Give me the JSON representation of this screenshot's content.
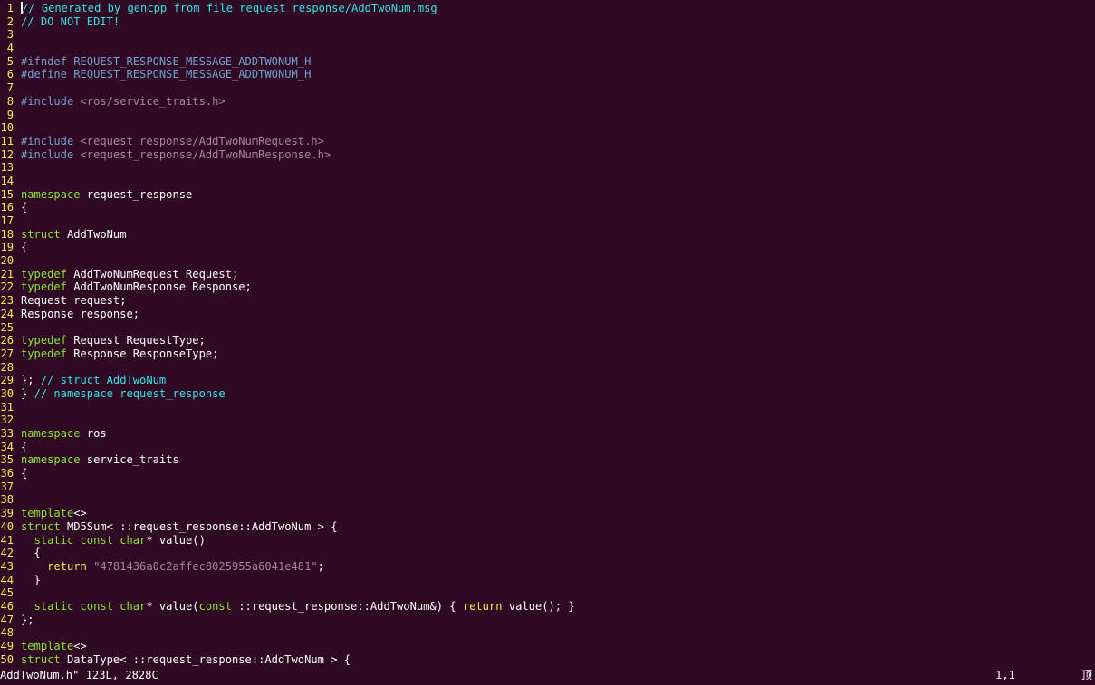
{
  "colors": {
    "background": "#300a24",
    "line_number": "#fce94f",
    "text": "#ffffff",
    "comment": "#34e2e2",
    "preproc": "#729fcf",
    "include_path": "#ad7fa8",
    "keyword": "#8ae234",
    "control": "#fce94f",
    "string": "#ad7fa8"
  },
  "editor": {
    "lines": [
      {
        "n": "1",
        "segs": [
          {
            "c": "comment",
            "t": "// Generated by gencpp from file request_response/AddTwoNum.msg"
          }
        ]
      },
      {
        "n": "2",
        "segs": [
          {
            "c": "comment",
            "t": "// DO NOT EDIT!"
          }
        ]
      },
      {
        "n": "3",
        "segs": []
      },
      {
        "n": "4",
        "segs": []
      },
      {
        "n": "5",
        "segs": [
          {
            "c": "preproc",
            "t": "#ifndef REQUEST_RESPONSE_MESSAGE_ADDTWONUM_H"
          }
        ]
      },
      {
        "n": "6",
        "segs": [
          {
            "c": "preproc",
            "t": "#define REQUEST_RESPONSE_MESSAGE_ADDTWONUM_H"
          }
        ]
      },
      {
        "n": "7",
        "segs": []
      },
      {
        "n": "8",
        "segs": [
          {
            "c": "preproc",
            "t": "#include "
          },
          {
            "c": "include_path",
            "t": "<ros/service_traits.h>"
          }
        ]
      },
      {
        "n": "9",
        "segs": []
      },
      {
        "n": "10",
        "segs": []
      },
      {
        "n": "11",
        "segs": [
          {
            "c": "preproc",
            "t": "#include "
          },
          {
            "c": "include_path",
            "t": "<request_response/AddTwoNumRequest.h>"
          }
        ]
      },
      {
        "n": "12",
        "segs": [
          {
            "c": "preproc",
            "t": "#include "
          },
          {
            "c": "include_path",
            "t": "<request_response/AddTwoNumResponse.h>"
          }
        ]
      },
      {
        "n": "13",
        "segs": []
      },
      {
        "n": "14",
        "segs": []
      },
      {
        "n": "15",
        "segs": [
          {
            "c": "keyword",
            "t": "namespace"
          },
          {
            "c": "text",
            "t": " request_response"
          }
        ]
      },
      {
        "n": "16",
        "segs": [
          {
            "c": "text",
            "t": "{"
          }
        ]
      },
      {
        "n": "17",
        "segs": []
      },
      {
        "n": "18",
        "segs": [
          {
            "c": "keyword",
            "t": "struct"
          },
          {
            "c": "text",
            "t": " AddTwoNum"
          }
        ]
      },
      {
        "n": "19",
        "segs": [
          {
            "c": "text",
            "t": "{"
          }
        ]
      },
      {
        "n": "20",
        "segs": []
      },
      {
        "n": "21",
        "segs": [
          {
            "c": "keyword",
            "t": "typedef"
          },
          {
            "c": "text",
            "t": " AddTwoNumRequest Request;"
          }
        ]
      },
      {
        "n": "22",
        "segs": [
          {
            "c": "keyword",
            "t": "typedef"
          },
          {
            "c": "text",
            "t": " AddTwoNumResponse Response;"
          }
        ]
      },
      {
        "n": "23",
        "segs": [
          {
            "c": "text",
            "t": "Request request;"
          }
        ]
      },
      {
        "n": "24",
        "segs": [
          {
            "c": "text",
            "t": "Response response;"
          }
        ]
      },
      {
        "n": "25",
        "segs": []
      },
      {
        "n": "26",
        "segs": [
          {
            "c": "keyword",
            "t": "typedef"
          },
          {
            "c": "text",
            "t": " Request RequestType;"
          }
        ]
      },
      {
        "n": "27",
        "segs": [
          {
            "c": "keyword",
            "t": "typedef"
          },
          {
            "c": "text",
            "t": " Response ResponseType;"
          }
        ]
      },
      {
        "n": "28",
        "segs": []
      },
      {
        "n": "29",
        "segs": [
          {
            "c": "text",
            "t": "}; "
          },
          {
            "c": "comment",
            "t": "// struct AddTwoNum"
          }
        ]
      },
      {
        "n": "30",
        "segs": [
          {
            "c": "text",
            "t": "} "
          },
          {
            "c": "comment",
            "t": "// namespace request_response"
          }
        ]
      },
      {
        "n": "31",
        "segs": []
      },
      {
        "n": "32",
        "segs": []
      },
      {
        "n": "33",
        "segs": [
          {
            "c": "keyword",
            "t": "namespace"
          },
          {
            "c": "text",
            "t": " ros"
          }
        ]
      },
      {
        "n": "34",
        "segs": [
          {
            "c": "text",
            "t": "{"
          }
        ]
      },
      {
        "n": "35",
        "segs": [
          {
            "c": "keyword",
            "t": "namespace"
          },
          {
            "c": "text",
            "t": " service_traits"
          }
        ]
      },
      {
        "n": "36",
        "segs": [
          {
            "c": "text",
            "t": "{"
          }
        ]
      },
      {
        "n": "37",
        "segs": []
      },
      {
        "n": "38",
        "segs": []
      },
      {
        "n": "39",
        "segs": [
          {
            "c": "keyword",
            "t": "template"
          },
          {
            "c": "text",
            "t": "<>"
          }
        ]
      },
      {
        "n": "40",
        "segs": [
          {
            "c": "keyword",
            "t": "struct"
          },
          {
            "c": "text",
            "t": " MD5Sum< ::request_response::AddTwoNum > {"
          }
        ]
      },
      {
        "n": "41",
        "segs": [
          {
            "c": "text",
            "t": "  "
          },
          {
            "c": "keyword",
            "t": "static const char"
          },
          {
            "c": "text",
            "t": "* value()"
          }
        ]
      },
      {
        "n": "42",
        "segs": [
          {
            "c": "text",
            "t": "  {"
          }
        ]
      },
      {
        "n": "43",
        "segs": [
          {
            "c": "text",
            "t": "    "
          },
          {
            "c": "control",
            "t": "return"
          },
          {
            "c": "text",
            "t": " "
          },
          {
            "c": "string",
            "t": "\"4781436a0c2affec8025955a6041e481\""
          },
          {
            "c": "text",
            "t": ";"
          }
        ]
      },
      {
        "n": "44",
        "segs": [
          {
            "c": "text",
            "t": "  }"
          }
        ]
      },
      {
        "n": "45",
        "segs": []
      },
      {
        "n": "46",
        "segs": [
          {
            "c": "text",
            "t": "  "
          },
          {
            "c": "keyword",
            "t": "static const char"
          },
          {
            "c": "text",
            "t": "* value("
          },
          {
            "c": "keyword",
            "t": "const"
          },
          {
            "c": "text",
            "t": " ::request_response::AddTwoNum&) { "
          },
          {
            "c": "control",
            "t": "return"
          },
          {
            "c": "text",
            "t": " value(); }"
          }
        ]
      },
      {
        "n": "47",
        "segs": [
          {
            "c": "text",
            "t": "};"
          }
        ]
      },
      {
        "n": "48",
        "segs": []
      },
      {
        "n": "49",
        "segs": [
          {
            "c": "keyword",
            "t": "template"
          },
          {
            "c": "text",
            "t": "<>"
          }
        ]
      },
      {
        "n": "50",
        "segs": [
          {
            "c": "keyword",
            "t": "struct"
          },
          {
            "c": "text",
            "t": " DataType< ::request_response::AddTwoNum > {"
          }
        ]
      }
    ]
  },
  "statusline": {
    "file_info": "AddTwoNum.h\" 123L, 2828C",
    "cursor_pos": "1,1",
    "scroll_pos": "顶"
  }
}
